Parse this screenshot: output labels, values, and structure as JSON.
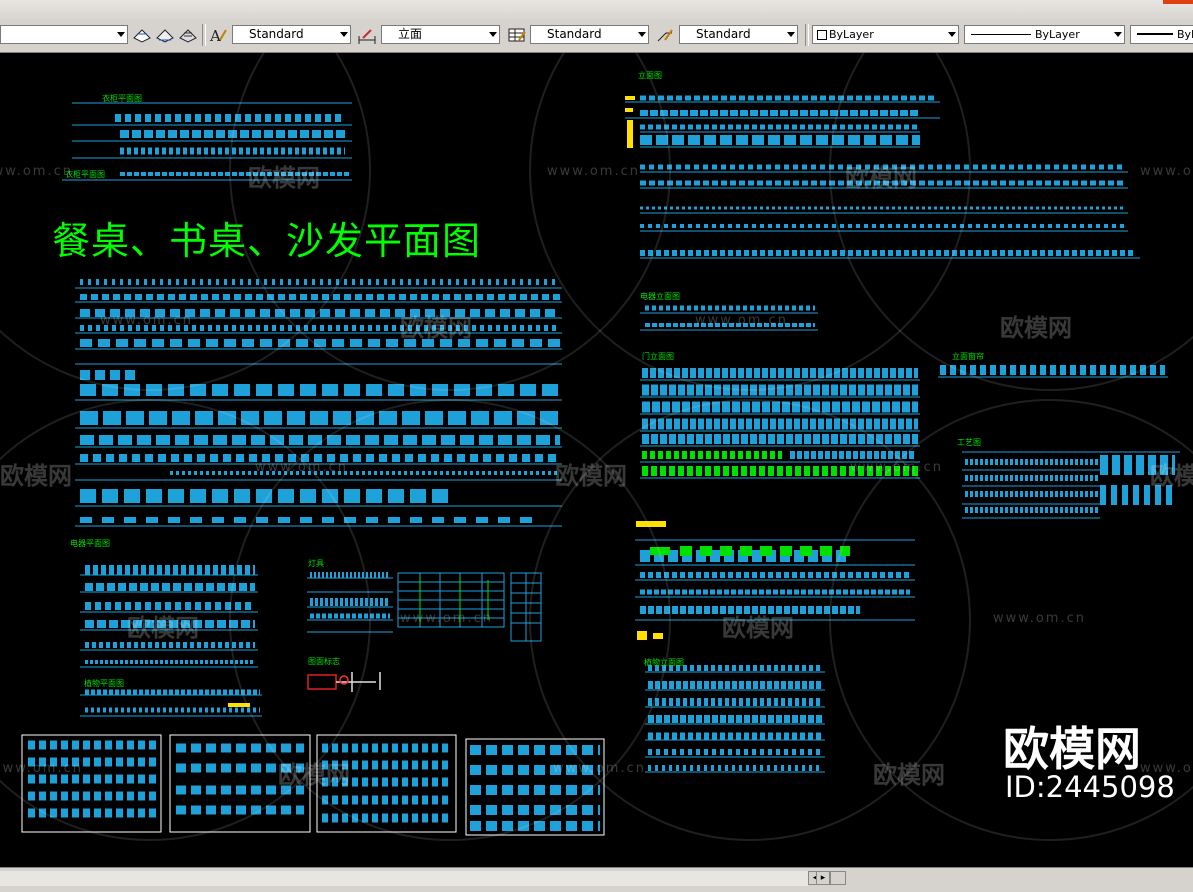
{
  "toolbar": {
    "text_style": "Standard",
    "dim_style": "立面",
    "table_style": "Standard",
    "multileader_style": "Standard",
    "color": "ByLayer",
    "linetype": "ByLayer",
    "lineweight": "ByL"
  },
  "drawing": {
    "title": "餐桌、书桌、沙发平面图",
    "sections": {
      "cabinet_plan": "衣柜平面图",
      "cabinet_plan_2": "衣柜平面图",
      "elevation": "立面图",
      "appliance_elevation": "电器立面图",
      "door_elevation": "门立面图",
      "appliance_plan": "电器平面图",
      "lamps": "灯具",
      "plan_marks": "图面标志",
      "plant_plan": "植物平面图",
      "plant_elevation": "植物立面图",
      "window_elevation": "立面窗帘",
      "craft_elevation": "工艺图"
    }
  },
  "watermark": {
    "brand": "欧模网",
    "url": "www.om.cn",
    "id_label": "ID:2445098"
  },
  "colors": {
    "canvas": "#000000",
    "line": "#1ea0d8",
    "label": "#00e000",
    "title": "#00ff00"
  }
}
